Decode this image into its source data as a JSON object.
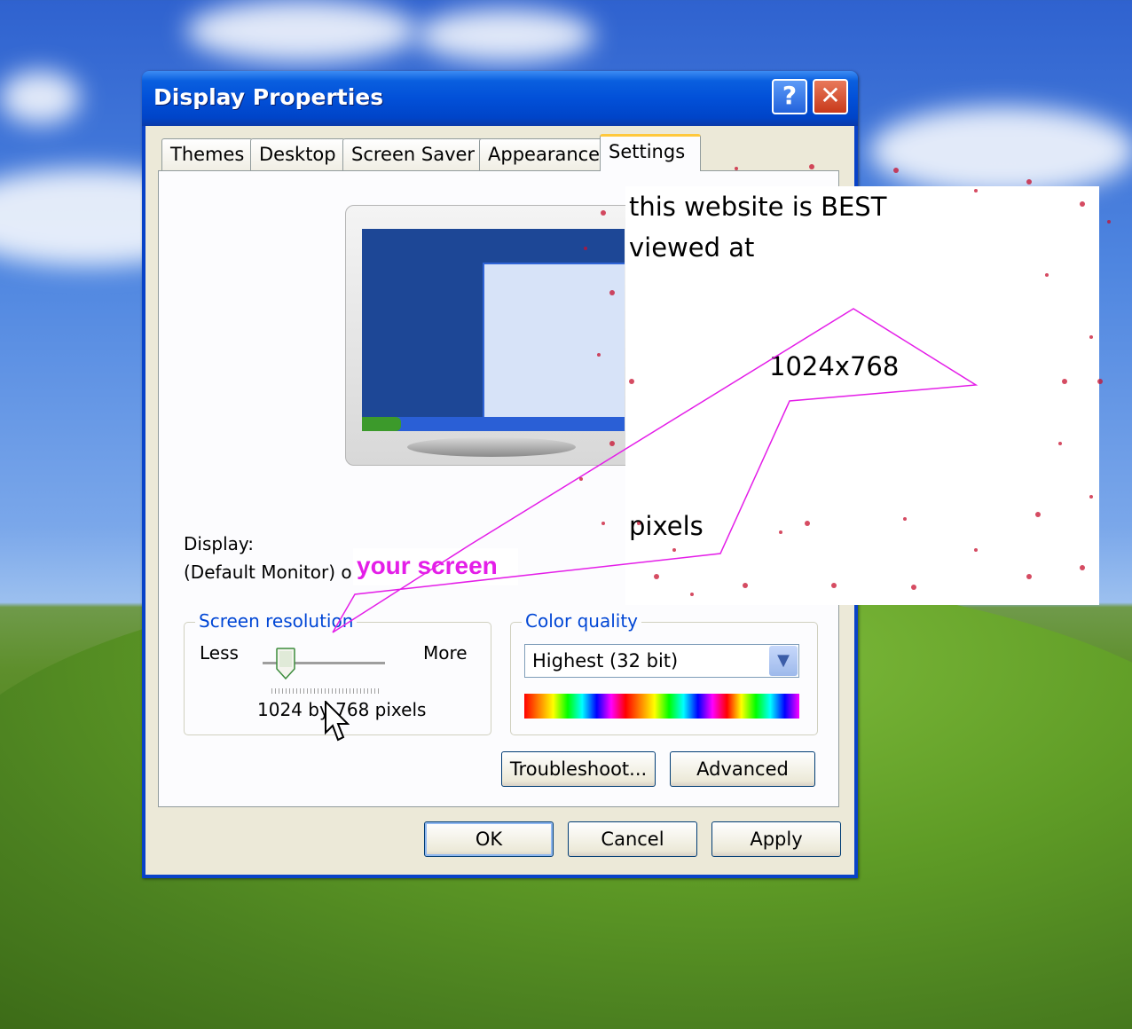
{
  "window": {
    "title": "Display Properties",
    "help_label": "?",
    "close_label": "✕"
  },
  "tabs": [
    {
      "label": "Themes"
    },
    {
      "label": "Desktop"
    },
    {
      "label": "Screen Saver"
    },
    {
      "label": "Appearance"
    },
    {
      "label": "Settings",
      "active": true
    }
  ],
  "display": {
    "label": "Display:",
    "value": "(Default Monitor) on",
    "overlay_text": "your screen"
  },
  "resolution": {
    "legend": "Screen resolution",
    "less": "Less",
    "more": "More",
    "value": "1024 by 768 pixels",
    "slider_position": 0.18
  },
  "color_quality": {
    "legend": "Color quality",
    "selected": "Highest (32 bit)"
  },
  "buttons": {
    "troubleshoot": "Troubleshoot...",
    "advanced": "Advanced",
    "ok": "OK",
    "cancel": "Cancel",
    "apply": "Apply"
  },
  "overlay_note": {
    "line1": "this website is BEST",
    "line2": "viewed at",
    "resolution": "1024x768",
    "pixels": "pixels"
  },
  "colors": {
    "accent_magenta": "#e41ee8",
    "title_blue": "#0250d8",
    "legend_blue": "#0046d5"
  }
}
